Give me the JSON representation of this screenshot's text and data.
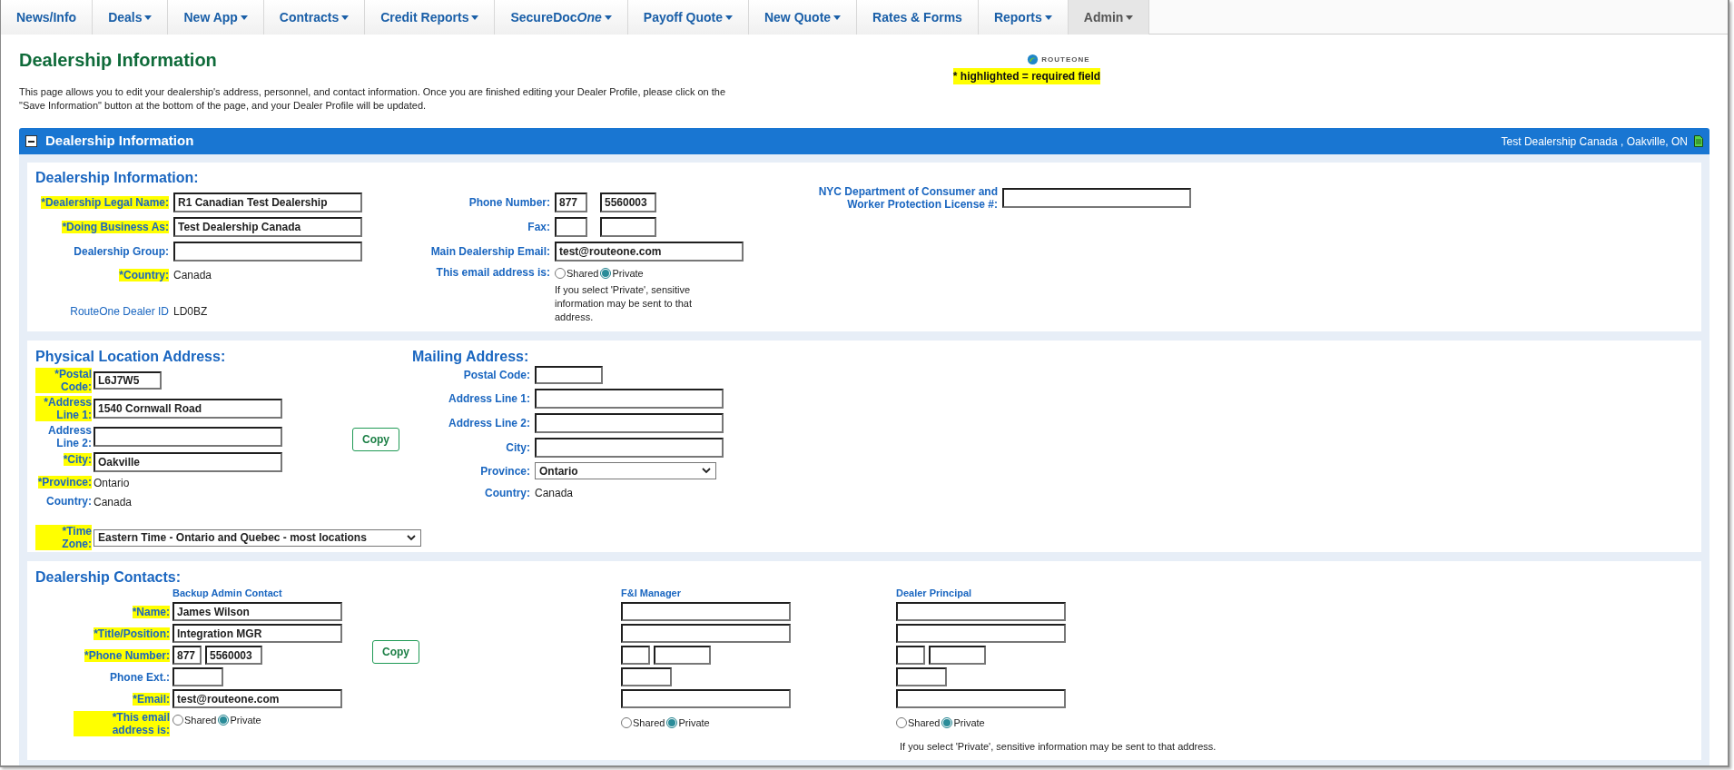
{
  "tabs": [
    {
      "label": "News/Info",
      "dropdown": false,
      "selected": false
    },
    {
      "label": "Deals",
      "dropdown": true,
      "selected": false
    },
    {
      "label": "New App",
      "dropdown": true,
      "selected": false
    },
    {
      "label": "Contracts",
      "dropdown": true,
      "selected": false
    },
    {
      "label": "Credit Reports",
      "dropdown": true,
      "selected": false
    },
    {
      "label": "SecureDoc",
      "label_italic": "One",
      "dropdown": true,
      "selected": false
    },
    {
      "label": "Payoff Quote",
      "dropdown": true,
      "selected": false
    },
    {
      "label": "New Quote",
      "dropdown": true,
      "selected": false
    },
    {
      "label": "Rates & Forms",
      "dropdown": false,
      "selected": false
    },
    {
      "label": "Reports",
      "dropdown": true,
      "selected": false
    },
    {
      "label": "Admin",
      "dropdown": true,
      "selected": true
    }
  ],
  "page": {
    "title": "Dealership Information",
    "description_lines": [
      "This page allows you to edit your dealership's address, personnel, and contact information. Once you are finished editing your Dealer Profile, please click on the",
      "\"Save Information\" button at the bottom of the page, and your Dealer Profile will be updated."
    ],
    "logo": "ROUTEONE",
    "required_note": "* highlighted = required field"
  },
  "panel": {
    "title": "Dealership Information",
    "location": "Test Dealership Canada , Oakville, ON",
    "expanded": true
  },
  "dealership": {
    "heading": "Dealership Information:",
    "columns": [
      [
        {
          "kind": "input",
          "label": "*Dealership Legal Name:",
          "required": true,
          "value": "R1 Canadian Test Dealership"
        },
        {
          "kind": "input",
          "label": "*Doing Business As:",
          "required": true,
          "value": "Test Dealership Canada"
        },
        {
          "kind": "input",
          "label": "Dealership Group:",
          "required": false
        },
        {
          "kind": "text",
          "label": "*Country:",
          "required": true,
          "value": "Canada"
        },
        {
          "kind": "id",
          "label": "RouteOne Dealer ID",
          "required": false,
          "value": "LD0BZ"
        }
      ],
      [
        {
          "kind": "phone",
          "label": "Phone Number:",
          "required": false,
          "values": [
            "877",
            "5560003"
          ]
        },
        {
          "kind": "phone",
          "label": "Fax:",
          "required": false
        },
        {
          "kind": "input",
          "label": "Main Dealership Email:",
          "required": false,
          "value": "test@routeone.com"
        },
        {
          "kind": "radio",
          "label": "This email address is:",
          "required": false,
          "options": [
            {
              "label": "Shared",
              "selected": false
            },
            {
              "label": "Private",
              "selected": true
            }
          ],
          "note": "If you select 'Private', sensitive information may be sent to that address."
        }
      ],
      [
        {
          "kind": "input",
          "label": "NYC Department of Consumer and Worker Protection License #:",
          "required": false
        }
      ]
    ]
  },
  "physical": {
    "heading": "Physical Location Address:",
    "fields": [
      {
        "kind": "postal",
        "label": "*Postal Code:",
        "required": true,
        "value": "L6J7W5"
      },
      {
        "kind": "input",
        "label": "*Address Line 1:",
        "required": true,
        "value": "1540 Cornwall Road"
      },
      {
        "kind": "input",
        "label": "Address Line 2:",
        "required": false
      },
      {
        "kind": "input",
        "label": "*City:",
        "required": true,
        "value": "Oakville"
      },
      {
        "kind": "text",
        "label": "*Province:",
        "required": true,
        "value": "Ontario"
      },
      {
        "kind": "text",
        "label": "Country:",
        "required": false,
        "value": "Canada"
      }
    ],
    "copy_button": "Copy",
    "time_zone": {
      "kind": "select",
      "label": "*Time Zone:",
      "required": true,
      "value": "Eastern Time - Ontario and Quebec - most locations"
    }
  },
  "mailing": {
    "heading": "Mailing Address:",
    "fields": [
      {
        "kind": "postal",
        "label": "Postal Code:",
        "required": false
      },
      {
        "kind": "input",
        "label": "Address Line 1:",
        "required": false
      },
      {
        "kind": "input",
        "label": "Address Line 2:",
        "required": false
      },
      {
        "kind": "input",
        "label": "City:",
        "required": false
      },
      {
        "kind": "select",
        "label": "Province:",
        "required": false,
        "value": "Ontario"
      },
      {
        "kind": "text",
        "label": "Country:",
        "required": false,
        "value": "Canada"
      }
    ]
  },
  "contacts": {
    "heading": "Dealership Contacts:",
    "copy_button": "Copy",
    "row_labels": [
      {
        "label": "*Name:",
        "required": true
      },
      {
        "label": "*Title/Position:",
        "required": true
      },
      {
        "label": "*Phone Number:",
        "required": true
      },
      {
        "label": "Phone Ext.:",
        "required": false
      },
      {
        "label": "*Email:",
        "required": true
      },
      {
        "label": "*This email address is:",
        "required": true
      }
    ],
    "columns": [
      {
        "heading": "Backup Admin Contact",
        "name": "James Wilson",
        "title": "Integration MGR",
        "phone_area": "877",
        "phone_number": "5560003",
        "email": "test@routeone.com",
        "email_type": [
          {
            "label": "Shared",
            "selected": false
          },
          {
            "label": "Private",
            "selected": true
          }
        ]
      },
      {
        "heading": "F&I Manager",
        "email_type": [
          {
            "label": "Shared",
            "selected": false
          },
          {
            "label": "Private",
            "selected": true
          }
        ]
      },
      {
        "heading": "Dealer Principal",
        "email_type": [
          {
            "label": "Shared",
            "selected": false
          },
          {
            "label": "Private",
            "selected": true
          }
        ],
        "note": "If you select 'Private', sensitive information may be sent to that address."
      }
    ]
  }
}
